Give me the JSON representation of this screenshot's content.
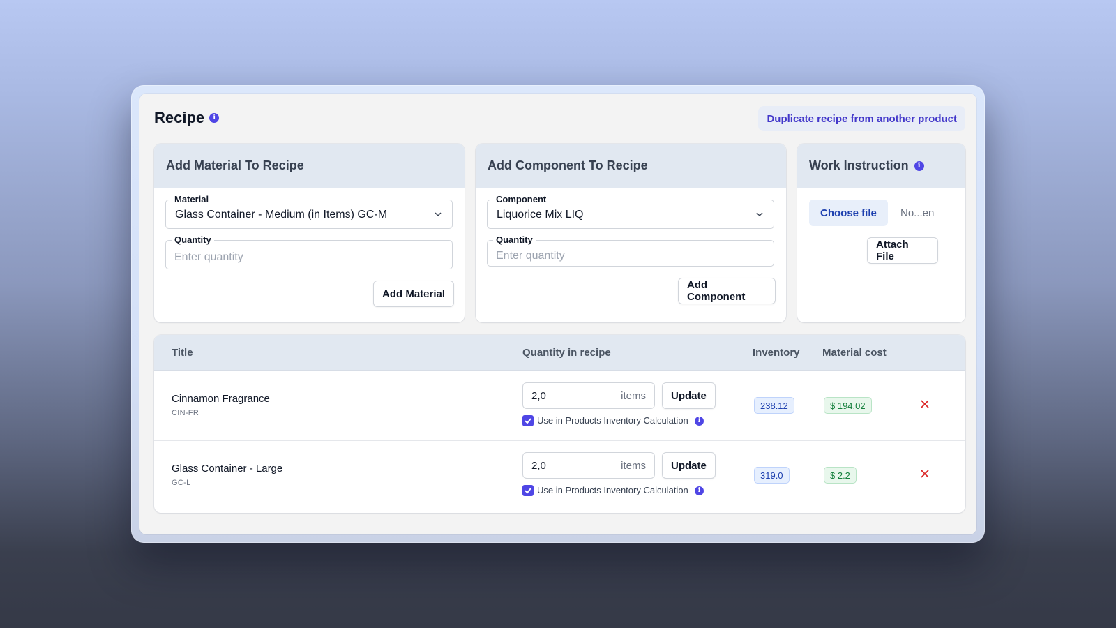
{
  "header": {
    "title": "Recipe",
    "duplicate_label": "Duplicate recipe from another product"
  },
  "material_panel": {
    "title": "Add Material To Recipe",
    "material_label": "Material",
    "material_value": "Glass Container - Medium (in Items) GC-M",
    "quantity_label": "Quantity",
    "quantity_placeholder": "Enter quantity",
    "add_label": "Add Material"
  },
  "component_panel": {
    "title": "Add Component To Recipe",
    "component_label": "Component",
    "component_value": "Liquorice Mix LIQ",
    "quantity_label": "Quantity",
    "quantity_placeholder": "Enter quantity",
    "add_label": "Add Component"
  },
  "work_panel": {
    "title": "Work Instruction",
    "choose_label": "Choose file",
    "file_status": "No...en",
    "attach_label": "Attach File"
  },
  "table": {
    "columns": [
      "Title",
      "Quantity in recipe",
      "Inventory",
      "Material cost"
    ],
    "rows": [
      {
        "title": "Cinnamon Fragrance",
        "code": "CIN-FR",
        "quantity": "2,0",
        "unit": "items",
        "update_label": "Update",
        "checkbox_label": "Use in Products Inventory Calculation",
        "checked": true,
        "inventory": "238.12",
        "cost": "$ 194.02"
      },
      {
        "title": "Glass Container - Large",
        "code": "GC-L",
        "quantity": "2,0",
        "unit": "items",
        "update_label": "Update",
        "checkbox_label": "Use in Products Inventory Calculation",
        "checked": true,
        "inventory": "319.0",
        "cost": "$ 2.2"
      }
    ]
  },
  "colors": {
    "accent": "#4f46e5",
    "panel_header": "#e1e8f1",
    "badge_blue": "#1e40af",
    "badge_green": "#15803d",
    "delete_red": "#dc2626"
  },
  "icons": [
    "info-icon",
    "chevron-down-icon",
    "checkmark-icon",
    "close-icon"
  ]
}
